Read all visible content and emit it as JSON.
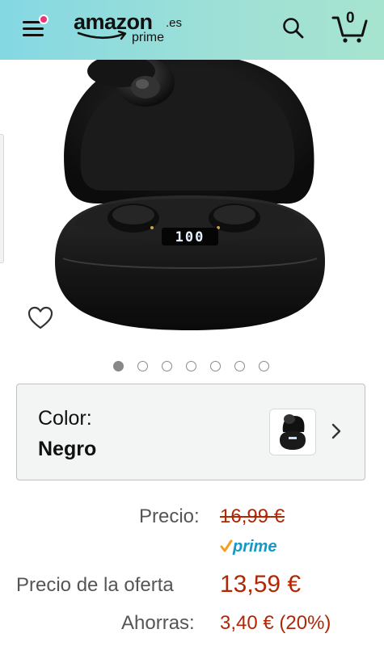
{
  "header": {
    "logo_word": "amazon",
    "logo_tld": ".es",
    "logo_sub": "prime",
    "cart_count": "0",
    "icons": {
      "menu": "menu-icon",
      "search": "search-icon",
      "cart": "cart-icon"
    },
    "colors": {
      "header_start": "#84d8e3",
      "header_end": "#a6e4cf",
      "notification_dot": "#e8347b"
    }
  },
  "gallery": {
    "total_images": 7,
    "active_index": 0,
    "wishlist_icon": "heart-outline-icon"
  },
  "variant": {
    "label": "Color:",
    "value": "Negro",
    "thumbnail_icon": "earbuds-case-thumbnail",
    "chevron_icon": "chevron-right-icon"
  },
  "pricing": {
    "list_label": "Precio:",
    "list_price": "16,99 €",
    "prime_label": "prime",
    "deal_label": "Precio de la oferta",
    "deal_price": "13,59 €",
    "savings_label": "Ahorras:",
    "savings_value": "3,40 € (20%)",
    "colors": {
      "price_red": "#b12704",
      "prime_blue": "#1399c6",
      "prime_check": "#f0a024"
    }
  }
}
